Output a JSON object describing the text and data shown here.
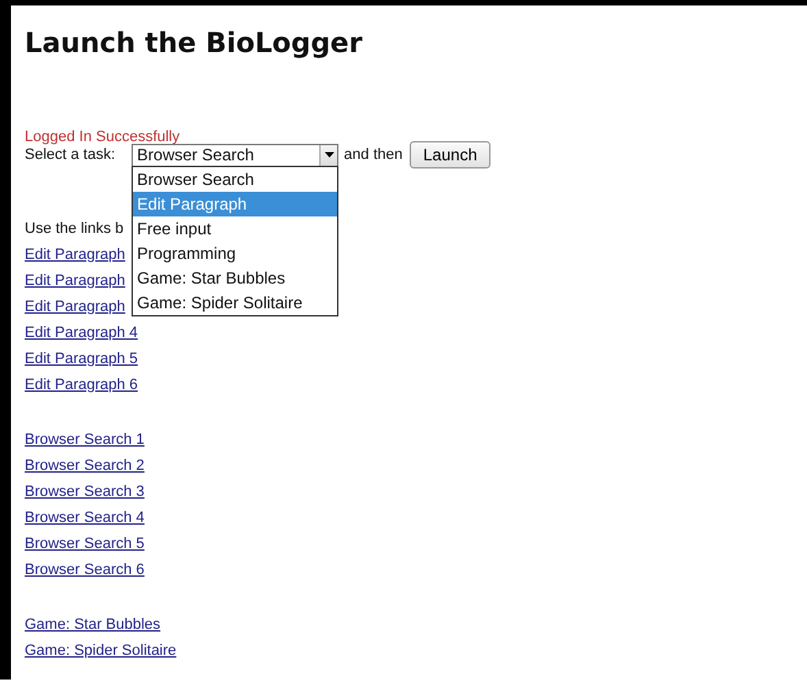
{
  "title": "Launch the BioLogger",
  "status_message": "Logged In Successfully",
  "task_row": {
    "label": "Select a task:",
    "select": {
      "value": "Browser Search",
      "expanded": true
    },
    "options": [
      {
        "label": "Browser Search",
        "selected": false
      },
      {
        "label": "Edit Paragraph",
        "selected": true
      },
      {
        "label": "Free input",
        "selected": false
      },
      {
        "label": "Programming",
        "selected": false
      },
      {
        "label": "Game: Star Bubbles",
        "selected": false
      },
      {
        "label": "Game: Spider Solitaire",
        "selected": false
      }
    ],
    "connector": "and then",
    "button": "Launch"
  },
  "instructions": "Use the links b",
  "link_groups": [
    [
      "Edit Paragraph",
      "Edit Paragraph",
      "Edit Paragraph",
      "Edit Paragraph 4",
      "Edit Paragraph 5",
      "Edit Paragraph 6"
    ],
    [
      "Browser Search 1",
      "Browser Search 2",
      "Browser Search 3",
      "Browser Search 4",
      "Browser Search 5",
      "Browser Search 6"
    ],
    [
      "Game: Star Bubbles",
      "Game: Spider Solitaire"
    ]
  ]
}
